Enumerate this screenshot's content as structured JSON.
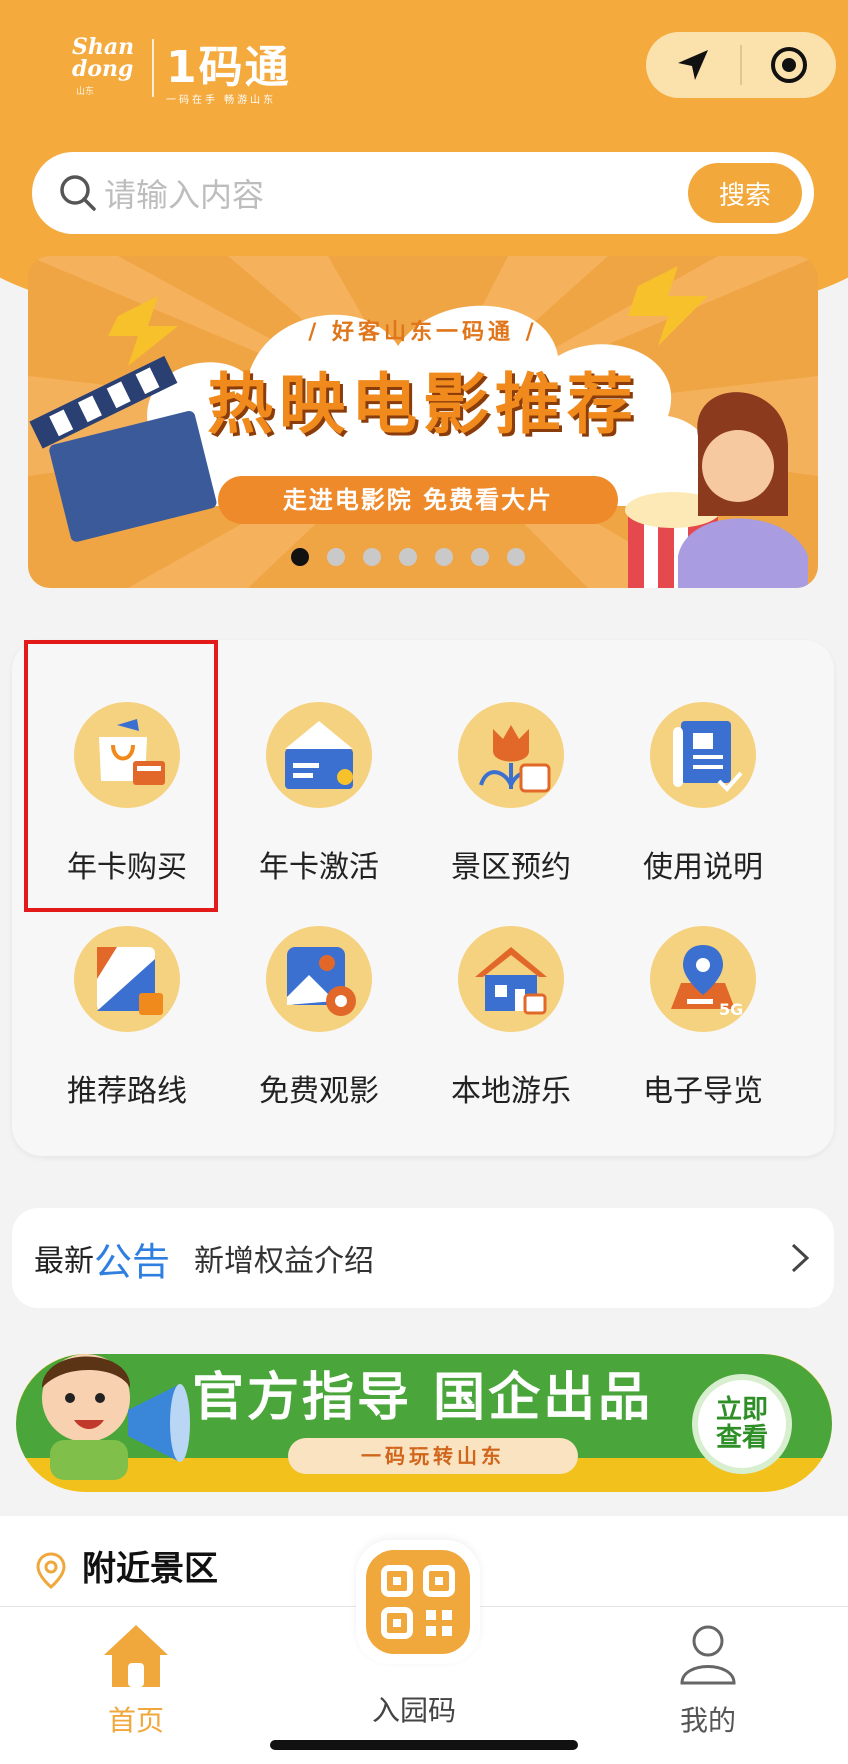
{
  "header": {
    "logo_region": "Shan dong",
    "logo_region_sub": "山东",
    "logo_title": "1码通",
    "logo_tagline": "一码在手 畅游山东"
  },
  "capsule": {
    "left_icon": "location-arrow-icon",
    "right_icon": "target-circle-icon"
  },
  "search": {
    "placeholder": "请输入内容",
    "button_label": "搜索"
  },
  "banner": {
    "subtitle": "/ 好客山东一码通 /",
    "title": "热映电影推荐",
    "pill": "走进电影院 免费看大片",
    "dots_total": 7,
    "dots_active": 1
  },
  "grid": {
    "items": [
      {
        "label": "年卡购买",
        "icon": "shopping-bag-card-icon"
      },
      {
        "label": "年卡激活",
        "icon": "envelope-card-icon"
      },
      {
        "label": "景区预约",
        "icon": "tulip-calendar-icon"
      },
      {
        "label": "使用说明",
        "icon": "manual-book-icon"
      },
      {
        "label": "推荐路线",
        "icon": "route-thumbs-up-icon"
      },
      {
        "label": "免费观影",
        "icon": "film-image-icon"
      },
      {
        "label": "本地游乐",
        "icon": "house-coffee-icon"
      },
      {
        "label": "电子导览",
        "icon": "map-pin-5g-icon"
      }
    ]
  },
  "notice": {
    "prefix": "最新",
    "highlight": "公告",
    "text": "新增权益介绍"
  },
  "ad": {
    "headline": "官方指导  国企出品",
    "sub": "一码玩转山东",
    "cta": "立即查看"
  },
  "nearby": {
    "title": "附近景区"
  },
  "tabbar": {
    "home": "首页",
    "qr": "入园码",
    "mine": "我的"
  },
  "colors": {
    "brand": "#f4aa3d",
    "link_blue": "#2e7fe0",
    "highlight_red": "#e21a1a"
  }
}
